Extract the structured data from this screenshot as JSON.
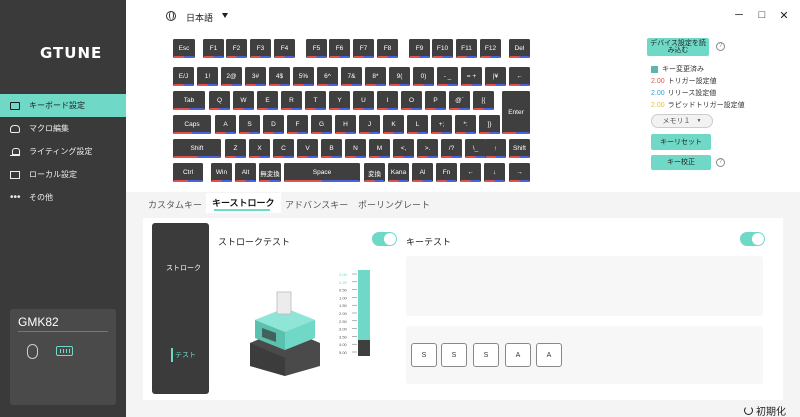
{
  "app": {
    "logo": "GTUNE"
  },
  "sidebar": {
    "items": [
      {
        "label": "キーボード設定",
        "icon": "keyboard-icon",
        "active": true
      },
      {
        "label": "マクロ編集",
        "icon": "mouse-icon"
      },
      {
        "label": "ライティング設定",
        "icon": "light-icon"
      },
      {
        "label": "ローカル設定",
        "icon": "local-icon"
      },
      {
        "label": "その他",
        "icon": "more-icon"
      }
    ],
    "device": {
      "name": "GMK82"
    }
  },
  "topbar": {
    "language": "日本語"
  },
  "keyboard": {
    "rows": [
      [
        "Esc",
        "F1",
        "F2",
        "F3",
        "F4",
        "F5",
        "F6",
        "F7",
        "F8",
        "F9",
        "F10",
        "F11",
        "F12",
        "Del"
      ],
      [
        "E/J",
        "1!",
        "2@",
        "3#",
        "4$",
        "5%",
        "6^",
        "7&",
        "8*",
        "9(",
        "0)",
        "- _",
        "= +",
        "|¥",
        "←"
      ],
      [
        "Tab",
        "Q",
        "W",
        "E",
        "R",
        "T",
        "Y",
        "U",
        "I",
        "O",
        "P",
        "@`",
        "[{",
        "Enter"
      ],
      [
        "Caps",
        "A",
        "S",
        "D",
        "F",
        "G",
        "H",
        "J",
        "K",
        "L",
        "+;",
        "*:",
        "]}"
      ],
      [
        "Shift",
        "Z",
        "X",
        "C",
        "V",
        "B",
        "N",
        "M",
        "<,",
        ">.",
        "/?",
        "\\_",
        "↑",
        "Shift"
      ],
      [
        "Ctrl",
        "Win",
        "Alt",
        "無変換",
        "Space",
        "変換",
        "Kana",
        "Al",
        "Fn",
        "←",
        "↓",
        "→"
      ]
    ]
  },
  "legend": {
    "read_settings": "デバイス設定を読み込む",
    "key_changed": "キー変更済み",
    "trigger": {
      "value": "2.00",
      "label": "トリガー設定値",
      "color": "#e0524f"
    },
    "release": {
      "value": "2.00",
      "label": "リリース設定値",
      "color": "#2f9fe0"
    },
    "rapid": {
      "value": "2.00",
      "label": "ラピッドトリガー設定値",
      "color": "#e8c233"
    },
    "memory": "メモリ１",
    "key_reset": "キーリセット",
    "key_calibrate": "キー校正"
  },
  "tabs": [
    "カスタムキー",
    "キーストローク",
    "アドバンスキー",
    "ポーリングレート"
  ],
  "stroke": {
    "panel_label": "ストローク",
    "test_label": "テスト",
    "stroke_test": "ストロークテスト",
    "gauge_ticks": [
      "0.00",
      "0.25",
      "0.50",
      "1.00",
      "1.50",
      "2.00",
      "2.50",
      "3.00",
      "3.50",
      "4.00",
      "5.00"
    ]
  },
  "key_test": {
    "label": "キーテスト",
    "keys": [
      "S",
      "S",
      "S",
      "A",
      "A"
    ]
  },
  "footer": {
    "reset": "初期化"
  },
  "colors": {
    "accent": "#6fd8c6",
    "sidebar": "#3a3a3a",
    "key": "#3f3f3f"
  }
}
